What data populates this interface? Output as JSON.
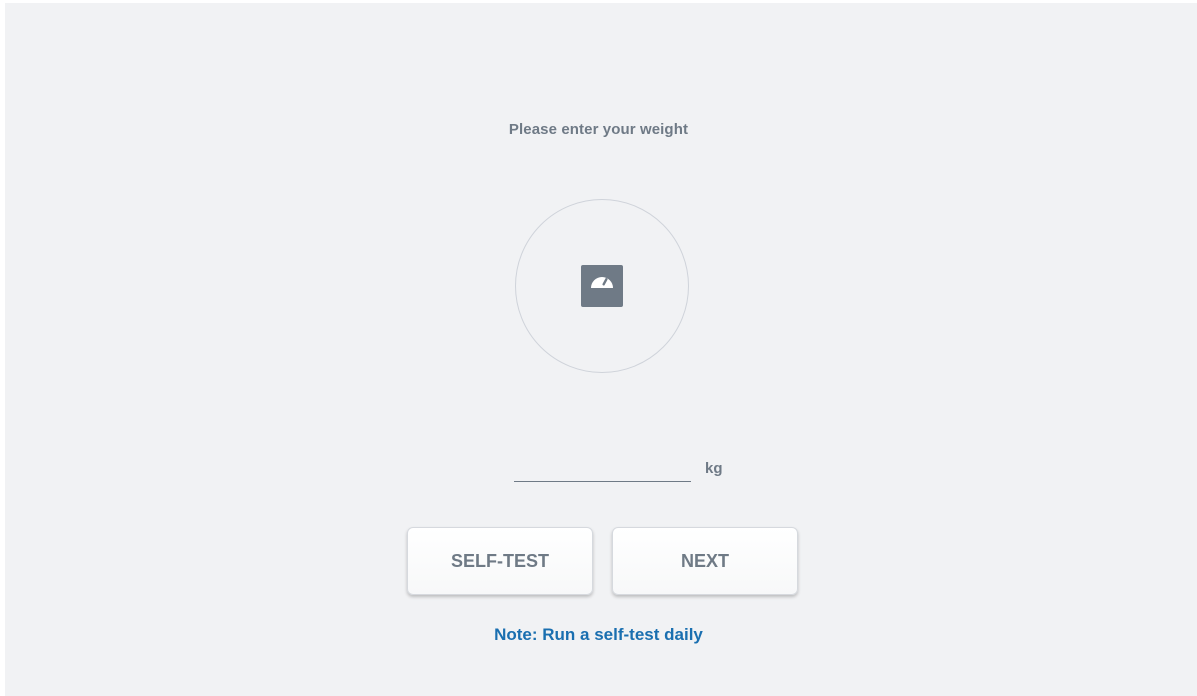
{
  "prompt": {
    "title": "Please enter your weight"
  },
  "scale": {
    "icon": "weighing-scale-icon"
  },
  "weight_field": {
    "value": "",
    "placeholder": "",
    "unit": "kg"
  },
  "buttons": {
    "self_test": "SELF-TEST",
    "next": "NEXT"
  },
  "note": {
    "text": "Note: Run a self-test daily"
  },
  "colors": {
    "background": "#f1f2f4",
    "text_muted": "#6f7a86",
    "note_blue": "#1a6fb0",
    "icon_gray": "#6f7a86"
  }
}
